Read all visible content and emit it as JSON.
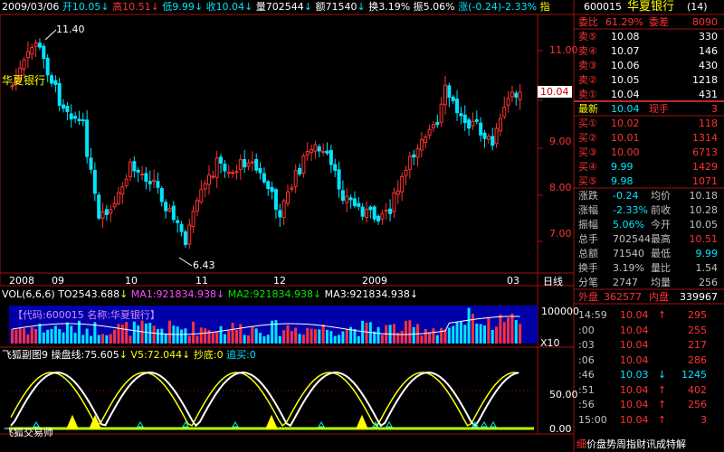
{
  "header": {
    "stock_name": "华夏银行",
    "date": "2009/03/06",
    "open_label": "开",
    "open": "10.05",
    "high_label": "高",
    "high": "10.51",
    "low_label": "低",
    "low": "9.99",
    "close_label": "收",
    "close": "10.04",
    "volume_label": "量",
    "volume": "702544",
    "amount_label": "额",
    "amount": "71540",
    "turnover_label": "换",
    "turnover": "3.19%",
    "amplitude_label": "振",
    "amplitude": "5.06%",
    "change_label": "涨",
    "change": "(-0.24)-2.33%",
    "truncated": "指"
  },
  "price_chart": {
    "max_label": "11.40",
    "min_label": "6.43",
    "current_price_tag": "10.04",
    "y_ticks": [
      "11.00",
      "10.00",
      "9.00",
      "8.00",
      "7.00"
    ],
    "x_labels": [
      "2008",
      "09",
      "10",
      "11",
      "12",
      "2009",
      "03"
    ],
    "period_label": "日线"
  },
  "volume_panel": {
    "title": "VOL(6,6,6)",
    "vol_value": "TO2543.688",
    "ma1": "MA1:921834.938",
    "ma2": "MA2:921834.938",
    "ma3": "MA3:921834.938",
    "code_banner": "【代码:600015 名称:华夏银行】",
    "y_top": "100000",
    "multiplier": "X10"
  },
  "indicator_panel": {
    "name": "飞狐副图9",
    "line1": "操盘线:75.605",
    "line2": "V5:72.044",
    "bottom_buy": "抄底:0",
    "chase_buy": "追买:0",
    "y_ticks": [
      "50.00",
      "0.00"
    ],
    "watermark": "飞狐交易师"
  },
  "quote_panel": {
    "code": "600015",
    "name": "华夏银行",
    "count": "(14)",
    "ratio_label": "委比",
    "ratio": "61.29%",
    "diff_label": "委差",
    "diff": "8090",
    "asks": [
      {
        "label": "卖⑤",
        "price": "10.08",
        "vol": "330"
      },
      {
        "label": "卖④",
        "price": "10.07",
        "vol": "146"
      },
      {
        "label": "卖③",
        "price": "10.06",
        "vol": "430"
      },
      {
        "label": "卖②",
        "price": "10.05",
        "vol": "1218"
      },
      {
        "label": "卖①",
        "price": "10.04",
        "vol": "431"
      }
    ],
    "last_label": "最新",
    "last": "10.04",
    "now_label": "现手",
    "now": "3",
    "bids": [
      {
        "label": "买①",
        "price": "10.02",
        "vol": "118"
      },
      {
        "label": "买②",
        "price": "10.01",
        "vol": "1314"
      },
      {
        "label": "买③",
        "price": "10.00",
        "vol": "6713"
      },
      {
        "label": "买④",
        "price": "9.99",
        "vol": "1429"
      },
      {
        "label": "买⑤",
        "price": "9.98",
        "vol": "1071"
      }
    ],
    "stats": [
      {
        "l1": "涨跌",
        "v1": "-0.24",
        "l2": "均价",
        "v2": "10.18"
      },
      {
        "l1": "涨幅",
        "v1": "-2.33%",
        "l2": "前收",
        "v2": "10.28"
      },
      {
        "l1": "振幅",
        "v1": "5.06%",
        "l2": "今开",
        "v2": "10.05"
      },
      {
        "l1": "总手",
        "v1": "702544",
        "l2": "最高",
        "v2": "10.51"
      },
      {
        "l1": "总额",
        "v1": "71540",
        "l2": "最低",
        "v2": "9.99"
      },
      {
        "l1": "换手",
        "v1": "3.19%",
        "l2": "量比",
        "v2": "1.54"
      },
      {
        "l1": "分笔",
        "v1": "2747",
        "l2": "均量",
        "v2": "256"
      }
    ],
    "outer_label": "外盘",
    "outer": "362577",
    "inner_label": "内盘",
    "inner": "339967",
    "ticks": [
      {
        "time": "14:59",
        "price": "10.04",
        "arrow": "↑",
        "vol": "295"
      },
      {
        "time": ":00",
        "price": "10.04",
        "arrow": "",
        "vol": "255"
      },
      {
        "time": ":03",
        "price": "10.04",
        "arrow": "",
        "vol": "217"
      },
      {
        "time": ":06",
        "price": "10.04",
        "arrow": "",
        "vol": "286"
      },
      {
        "time": ":46",
        "price": "10.03",
        "arrow": "↓",
        "vol": "1245"
      },
      {
        "time": ":51",
        "price": "10.04",
        "arrow": "↑",
        "vol": "402"
      },
      {
        "time": ":56",
        "price": "10.04",
        "arrow": "↑",
        "vol": "256"
      },
      {
        "time": "15:00",
        "price": "10.04",
        "arrow": "↑",
        "vol": "3"
      }
    ],
    "footer": "价盘势周指财讯成特解",
    "footer_marker": "细"
  },
  "colors": {
    "up": "#ff3232",
    "down": "#00e5ff",
    "label": "#ff3232",
    "price_line": "#00e5ff"
  }
}
